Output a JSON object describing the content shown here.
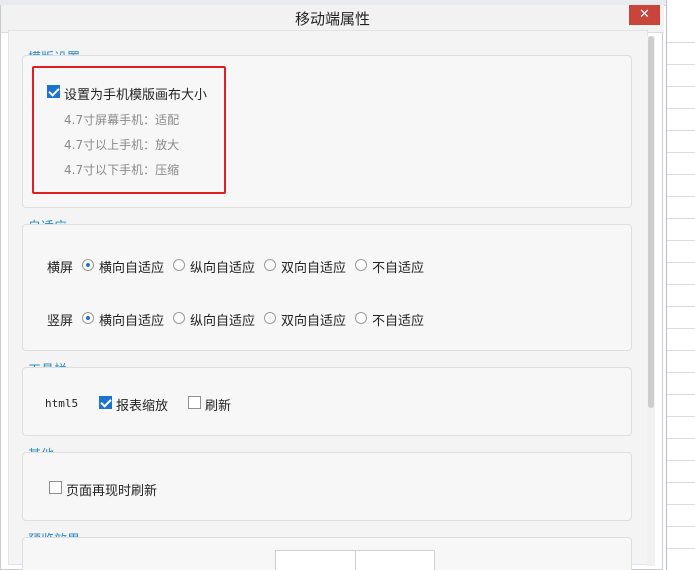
{
  "window": {
    "title": "移动端属性",
    "close_symbol": "✕"
  },
  "template_settings": {
    "section_label": "模版设置",
    "fit_canvas": {
      "label": "设置为手机模版画布大小",
      "checked": true
    },
    "hints": [
      "4.7寸屏幕手机：适配",
      "4.7寸以上手机：放大",
      "4.7寸以下手机：压缩"
    ]
  },
  "adaptive": {
    "section_label": "自适应",
    "options": [
      "横向自适应",
      "纵向自适应",
      "双向自适应",
      "不自适应"
    ],
    "landscape": {
      "label": "横屏",
      "selected": "横向自适应"
    },
    "portrait": {
      "label": "竖屏",
      "selected": "横向自适应"
    }
  },
  "toolbar": {
    "section_label": "工具栏",
    "row_label": "html5",
    "zoom": {
      "label": "报表缩放",
      "checked": true
    },
    "refresh": {
      "label": "刷新",
      "checked": false
    }
  },
  "other": {
    "section_label": "其他",
    "refresh_on_reappear": {
      "label": "页面再现时刷新",
      "checked": false
    }
  },
  "preview": {
    "section_label": "预览效果"
  }
}
